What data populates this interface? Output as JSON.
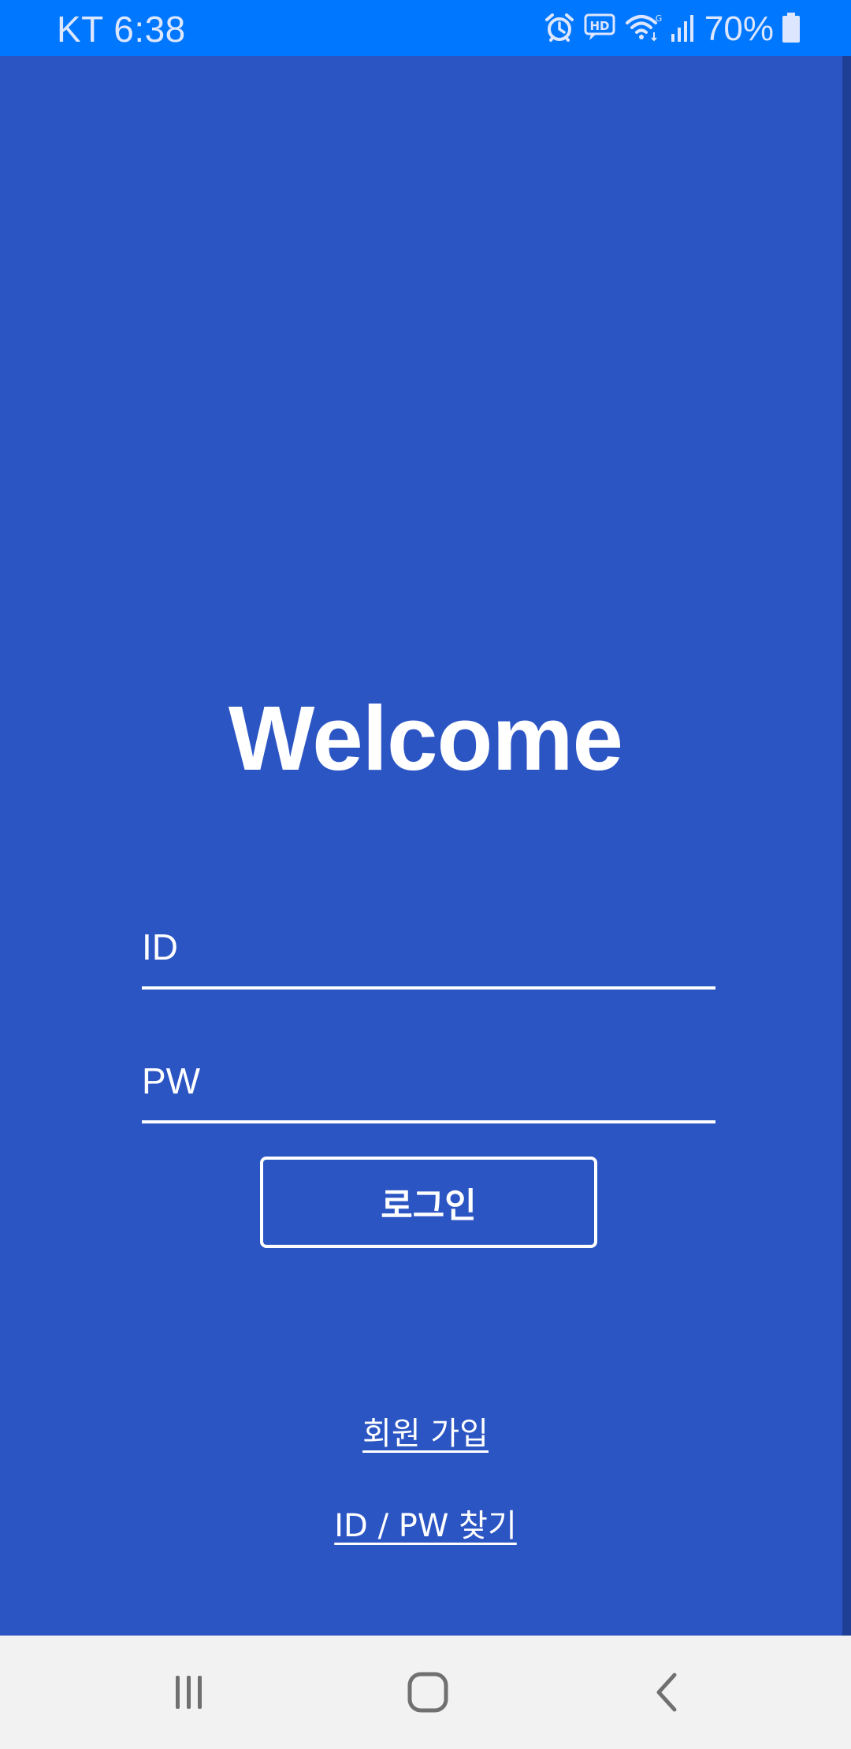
{
  "status_bar": {
    "carrier_time": "KT 6:38",
    "battery_percent": "70%",
    "icons": [
      "alarm-icon",
      "hd-voice-icon",
      "wifi-icon",
      "signal-icon",
      "battery-icon"
    ],
    "background_color": "#0077ff"
  },
  "main": {
    "background_color": "#2c55c4",
    "title": "Welcome",
    "id_field": {
      "placeholder": "ID",
      "value": ""
    },
    "pw_field": {
      "placeholder": "PW",
      "value": ""
    },
    "login_label": "로그인",
    "signup_link": "회원 가입",
    "find_link": "ID / PW 찾기"
  },
  "nav_bar": {
    "buttons": [
      "recents-icon",
      "home-icon",
      "back-icon"
    ],
    "background_color": "#f2f2f2"
  }
}
